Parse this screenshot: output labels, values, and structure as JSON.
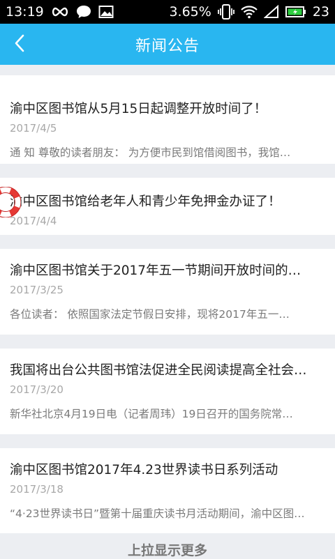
{
  "status_bar": {
    "time": "13:19",
    "battery_percent_text": "3.65%",
    "battery_level": "23"
  },
  "header": {
    "title": "新闻公告"
  },
  "news": [
    {
      "title": "渝中区图书馆从5月15日起调整开放时间了！",
      "date": "2017/4/5",
      "summary": "通 知 尊敬的读者朋友： 为方便市民到馆借阅图书，我馆…"
    },
    {
      "title": "渝中区图书馆给老年人和青少年免押金办证了！",
      "date": "2017/4/4",
      "summary": ""
    },
    {
      "title": "渝中区图书馆关于2017年五一节期间开放时间的…",
      "date": "2017/3/25",
      "summary": "各位读者： 依照国家法定节假日安排，现将2017年五一…"
    },
    {
      "title": "我国将出台公共图书馆法促进全民阅读提高全社会…",
      "date": "2017/3/20",
      "summary": "新华社北京4月19日电（记者周玮）19日召开的国务院常…"
    },
    {
      "title": "渝中区图书馆2017年4.23世界读书日系列活动",
      "date": "2017/3/18",
      "summary": "“4·23世界读书日”暨第十届重庆读书月活动期间，渝中区图…"
    }
  ],
  "footer": {
    "load_more": "上拉显示更多"
  },
  "icons": {
    "back": "chevron-left-icon",
    "float": "lifebuoy-icon"
  },
  "colors": {
    "header": "#29b6f0",
    "background": "#eceef2"
  }
}
